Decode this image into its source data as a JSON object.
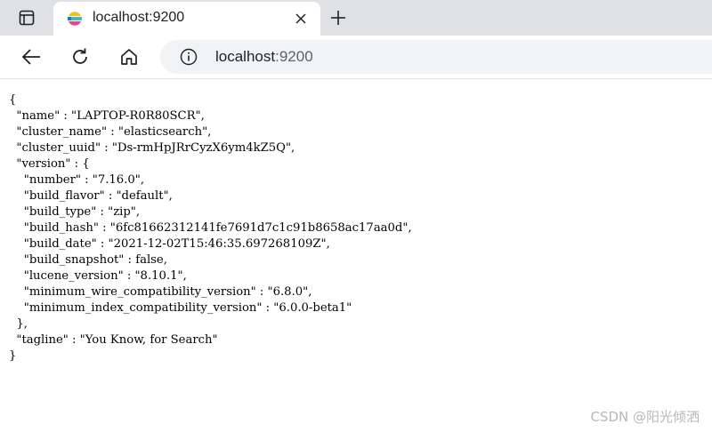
{
  "browser": {
    "tab": {
      "title": "localhost:9200"
    },
    "address_bar": {
      "host": "localhost",
      "port": ":9200"
    }
  },
  "page": {
    "json_lines": [
      "{",
      "  \"name\" : \"LAPTOP-R0R80SCR\",",
      "  \"cluster_name\" : \"elasticsearch\",",
      "  \"cluster_uuid\" : \"Ds-rmHpJRrCyzX6ym4kZ5Q\",",
      "  \"version\" : {",
      "    \"number\" : \"7.16.0\",",
      "    \"build_flavor\" : \"default\",",
      "    \"build_type\" : \"zip\",",
      "    \"build_hash\" : \"6fc81662312141fe7691d7c1c91b8658ac17aa0d\",",
      "    \"build_date\" : \"2021-12-02T15:46:35.697268109Z\",",
      "    \"build_snapshot\" : false,",
      "    \"lucene_version\" : \"8.10.1\",",
      "    \"minimum_wire_compatibility_version\" : \"6.8.0\",",
      "    \"minimum_index_compatibility_version\" : \"6.0.0-beta1\"",
      "  },",
      "  \"tagline\" : \"You Know, for Search\"",
      "}"
    ]
  },
  "watermark": "CSDN @阳光倾洒",
  "icons": {
    "tab_actions": "tab-actions-icon",
    "favicon": "elastic-logo-icon",
    "close": "close-icon",
    "new_tab": "plus-icon",
    "back": "back-arrow-icon",
    "refresh": "refresh-icon",
    "home": "home-icon",
    "site_info": "info-icon"
  },
  "colors": {
    "tabstrip_bg": "#dfe1e5",
    "omnibox_bg": "#f1f3f4",
    "favicon_yellow": "#f0bf1a",
    "favicon_teal": "#3ebeb0",
    "favicon_pink": "#e9478b",
    "favicon_blue": "#07c"
  }
}
